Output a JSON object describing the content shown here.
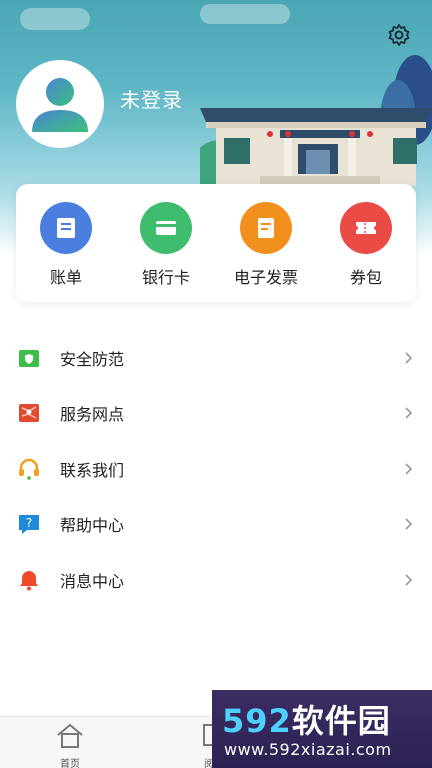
{
  "header": {
    "login_text": "未登录",
    "settings_icon": "gear-icon"
  },
  "quick_actions": [
    {
      "label": "账单",
      "icon": "bill-icon",
      "color": "#4a7fe0"
    },
    {
      "label": "银行卡",
      "icon": "bank-card-icon",
      "color": "#3dbd6d"
    },
    {
      "label": "电子发票",
      "icon": "e-invoice-icon",
      "color": "#f2901d"
    },
    {
      "label": "券包",
      "icon": "coupon-icon",
      "color": "#ea4b45"
    }
  ],
  "menu": [
    {
      "label": "安全防范",
      "icon": "shield-icon",
      "color": "#3dbd4a"
    },
    {
      "label": "服务网点",
      "icon": "map-icon",
      "color": "#e24a2f"
    },
    {
      "label": "联系我们",
      "icon": "headset-icon",
      "color": "#f2a01d"
    },
    {
      "label": "帮助中心",
      "icon": "help-icon",
      "color": "#1f8ad9"
    },
    {
      "label": "消息中心",
      "icon": "bell-icon",
      "color": "#f04a2a"
    }
  ],
  "tabbar": {
    "tabs": [
      {
        "label": "首页",
        "icon": "home-icon"
      },
      {
        "label": "阅读",
        "icon": "reading-icon"
      }
    ]
  },
  "watermark": {
    "number": "592",
    "site": "软件园",
    "url": "www.592xiazai.com"
  }
}
